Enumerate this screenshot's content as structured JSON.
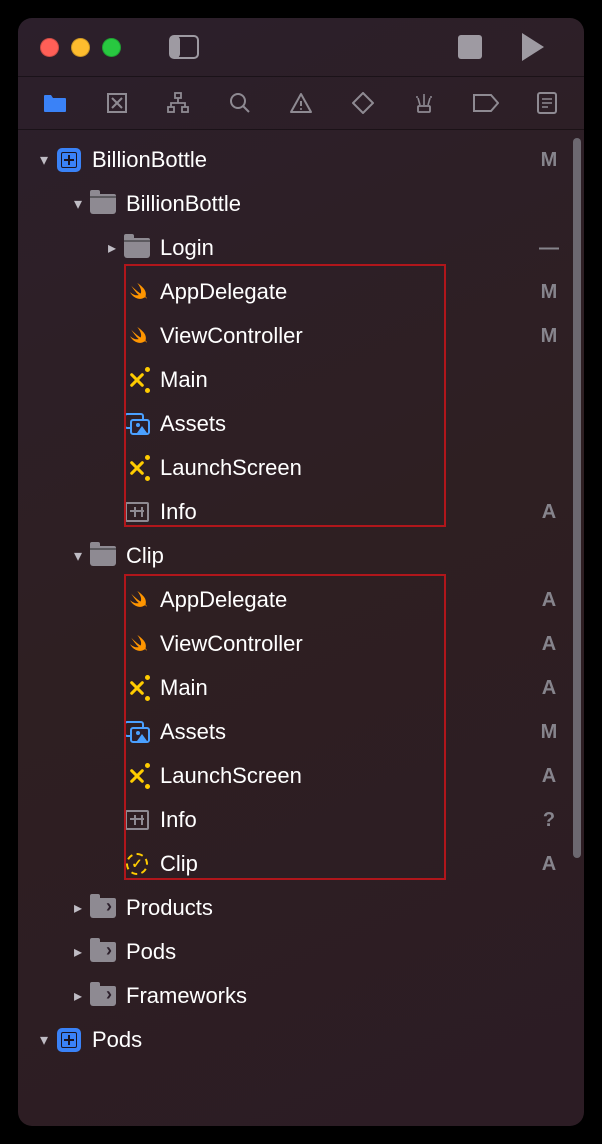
{
  "titlebar": {
    "sidebar_toggle": "sidebar-toggle",
    "stop": "stop",
    "run": "run"
  },
  "navbar": {
    "project": "project-navigator",
    "source_control": "source-control-navigator",
    "symbol": "symbol-navigator",
    "find": "find-navigator",
    "issue": "issue-navigator",
    "test": "test-navigator",
    "debug": "debug-navigator",
    "breakpoint": "breakpoint-navigator",
    "report": "report-navigator"
  },
  "tree": {
    "root": {
      "name": "BillionBottle",
      "status": "M"
    },
    "folder_app": {
      "name": "BillionBottle",
      "status": ""
    },
    "login": {
      "name": "Login",
      "status": "—"
    },
    "app_files": [
      {
        "name": "AppDelegate",
        "status": "M",
        "icon": "swift"
      },
      {
        "name": "ViewController",
        "status": "M",
        "icon": "swift"
      },
      {
        "name": "Main",
        "status": "",
        "icon": "storyboard"
      },
      {
        "name": "Assets",
        "status": "",
        "icon": "assets"
      },
      {
        "name": "LaunchScreen",
        "status": "",
        "icon": "storyboard"
      },
      {
        "name": "Info",
        "status": "A",
        "icon": "plist"
      }
    ],
    "folder_clip": {
      "name": "Clip",
      "status": ""
    },
    "clip_files": [
      {
        "name": "AppDelegate",
        "status": "A",
        "icon": "swift"
      },
      {
        "name": "ViewController",
        "status": "A",
        "icon": "swift"
      },
      {
        "name": "Main",
        "status": "A",
        "icon": "storyboard"
      },
      {
        "name": "Assets",
        "status": "M",
        "icon": "assets"
      },
      {
        "name": "LaunchScreen",
        "status": "A",
        "icon": "storyboard"
      },
      {
        "name": "Info",
        "status": "?",
        "icon": "plist"
      },
      {
        "name": "Clip",
        "status": "A",
        "icon": "appclip"
      }
    ],
    "rest": [
      {
        "name": "Products",
        "status": "",
        "indent": 2,
        "icon": "folder-ref"
      },
      {
        "name": "Pods",
        "status": "",
        "indent": 2,
        "icon": "folder-ref"
      },
      {
        "name": "Frameworks",
        "status": "",
        "indent": 2,
        "icon": "folder-ref"
      }
    ],
    "pods_project": {
      "name": "Pods",
      "status": ""
    }
  }
}
